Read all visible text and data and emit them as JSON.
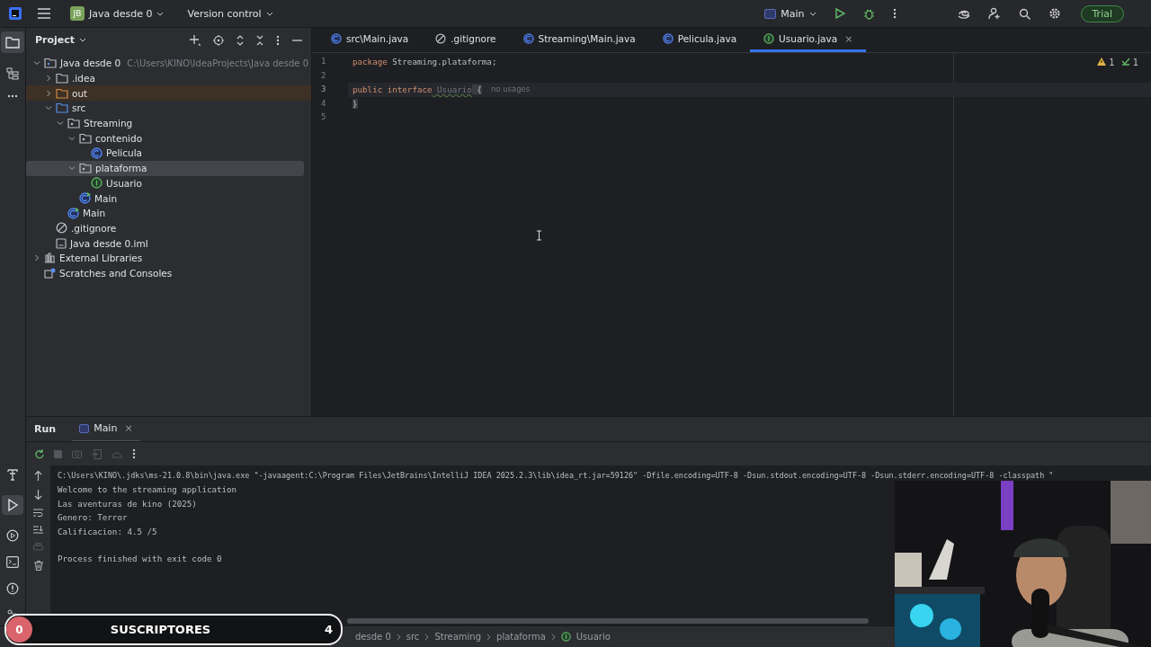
{
  "toolbar": {
    "project_badge": "JB",
    "project": "Java desde 0",
    "vcs": "Version control",
    "run_config": "Main",
    "trial": "Trial"
  },
  "project_panel": {
    "title": "Project",
    "tree": [
      {
        "label": "Java desde 0",
        "path": "C:\\Users\\KINO\\IdeaProjects\\Java desde 0",
        "kind": "module",
        "expanded": true,
        "selected": false,
        "children": [
          {
            "label": ".idea",
            "kind": "folder",
            "expanded": false,
            "selected": false
          },
          {
            "label": "out",
            "kind": "excluded-folder",
            "expanded": false,
            "selected": false
          },
          {
            "label": "src",
            "kind": "source-folder",
            "expanded": true,
            "selected": false,
            "children": [
              {
                "label": "Streaming",
                "kind": "package",
                "expanded": true,
                "selected": false,
                "children": [
                  {
                    "label": "contenido",
                    "kind": "package",
                    "expanded": true,
                    "selected": false,
                    "children": [
                      {
                        "label": "Pelicula",
                        "kind": "class",
                        "selected": false
                      }
                    ]
                  },
                  {
                    "label": "plataforma",
                    "kind": "package",
                    "expanded": true,
                    "selected": true,
                    "children": [
                      {
                        "label": "Usuario",
                        "kind": "interface",
                        "selected": false
                      }
                    ]
                  },
                  {
                    "label": "Main",
                    "kind": "main",
                    "selected": false
                  }
                ]
              },
              {
                "label": "Main",
                "kind": "main",
                "selected": false
              }
            ]
          },
          {
            "label": ".gitignore",
            "kind": "ignored",
            "selected": false
          },
          {
            "label": "Java desde 0.iml",
            "kind": "iml",
            "selected": false
          }
        ]
      },
      {
        "label": "External Libraries",
        "kind": "libraries",
        "expanded": false,
        "selected": false
      },
      {
        "label": "Scratches and Consoles",
        "kind": "scratches",
        "selected": false
      }
    ]
  },
  "editor_tabs": [
    {
      "label": "src\\Main.java",
      "kind": "main",
      "selected": false
    },
    {
      "label": ".gitignore",
      "kind": "ignored",
      "selected": false
    },
    {
      "label": "Streaming\\Main.java",
      "kind": "main",
      "selected": false
    },
    {
      "label": "Pelicula.java",
      "kind": "class",
      "selected": false
    },
    {
      "label": "Usuario.java",
      "kind": "interface",
      "selected": true,
      "close": "×"
    }
  ],
  "editor": {
    "warnings": "1",
    "checks": "1",
    "lines": [
      {
        "number": "1",
        "current": false,
        "tokens": [
          {
            "text": "package",
            "kind": "keyword"
          },
          {
            "text": " Streaming.plataforma;",
            "kind": "plain"
          }
        ]
      },
      {
        "number": "2",
        "current": false
      },
      {
        "number": "3",
        "current": true,
        "tokens": [
          {
            "text": "public",
            "kind": "keyword"
          },
          {
            "text": " interface",
            "kind": "keyword"
          },
          {
            "text": " Usuario",
            "kind": "unused"
          },
          {
            "text": " {",
            "kind": "brace"
          }
        ],
        "hint": "no usages"
      },
      {
        "number": "4",
        "current": false,
        "tokens": [
          {
            "text": "}",
            "kind": "brace"
          }
        ]
      },
      {
        "number": "5",
        "current": false
      }
    ]
  },
  "run_panel": {
    "title": "Run",
    "tab": "Main",
    "tab_close": "×",
    "console": [
      {
        "kind": "command",
        "text": "C:\\Users\\KINO\\.jdks\\ms-21.0.8\\bin\\java.exe \"-javaagent:C:\\Program Files\\JetBrains\\IntelliJ IDEA 2025.2.3\\lib\\idea_rt.jar=59126\" -Dfile.encoding=UTF-8 -Dsun.stdout.encoding=UTF-8 -Dsun.stderr.encoding=UTF-8 -classpath \""
      },
      {
        "kind": "output",
        "text": "Welcome to the streaming application"
      },
      {
        "kind": "output",
        "text": "Las aventuras de kino (2025)"
      },
      {
        "kind": "output",
        "text": "Genero: Terror"
      },
      {
        "kind": "output",
        "text": "Calificacion: 4.5 /5"
      },
      {
        "kind": "exit",
        "text": "Process finished with exit code 0"
      }
    ]
  },
  "breadcrumbs": [
    "desde 0",
    "src",
    "Streaming",
    "plataforma",
    "Usuario"
  ],
  "stream_overlay": {
    "left_count": "0",
    "label": "SUSCRIPTORES",
    "right_count": "4"
  },
  "webcam": {
    "kind": "picture"
  }
}
